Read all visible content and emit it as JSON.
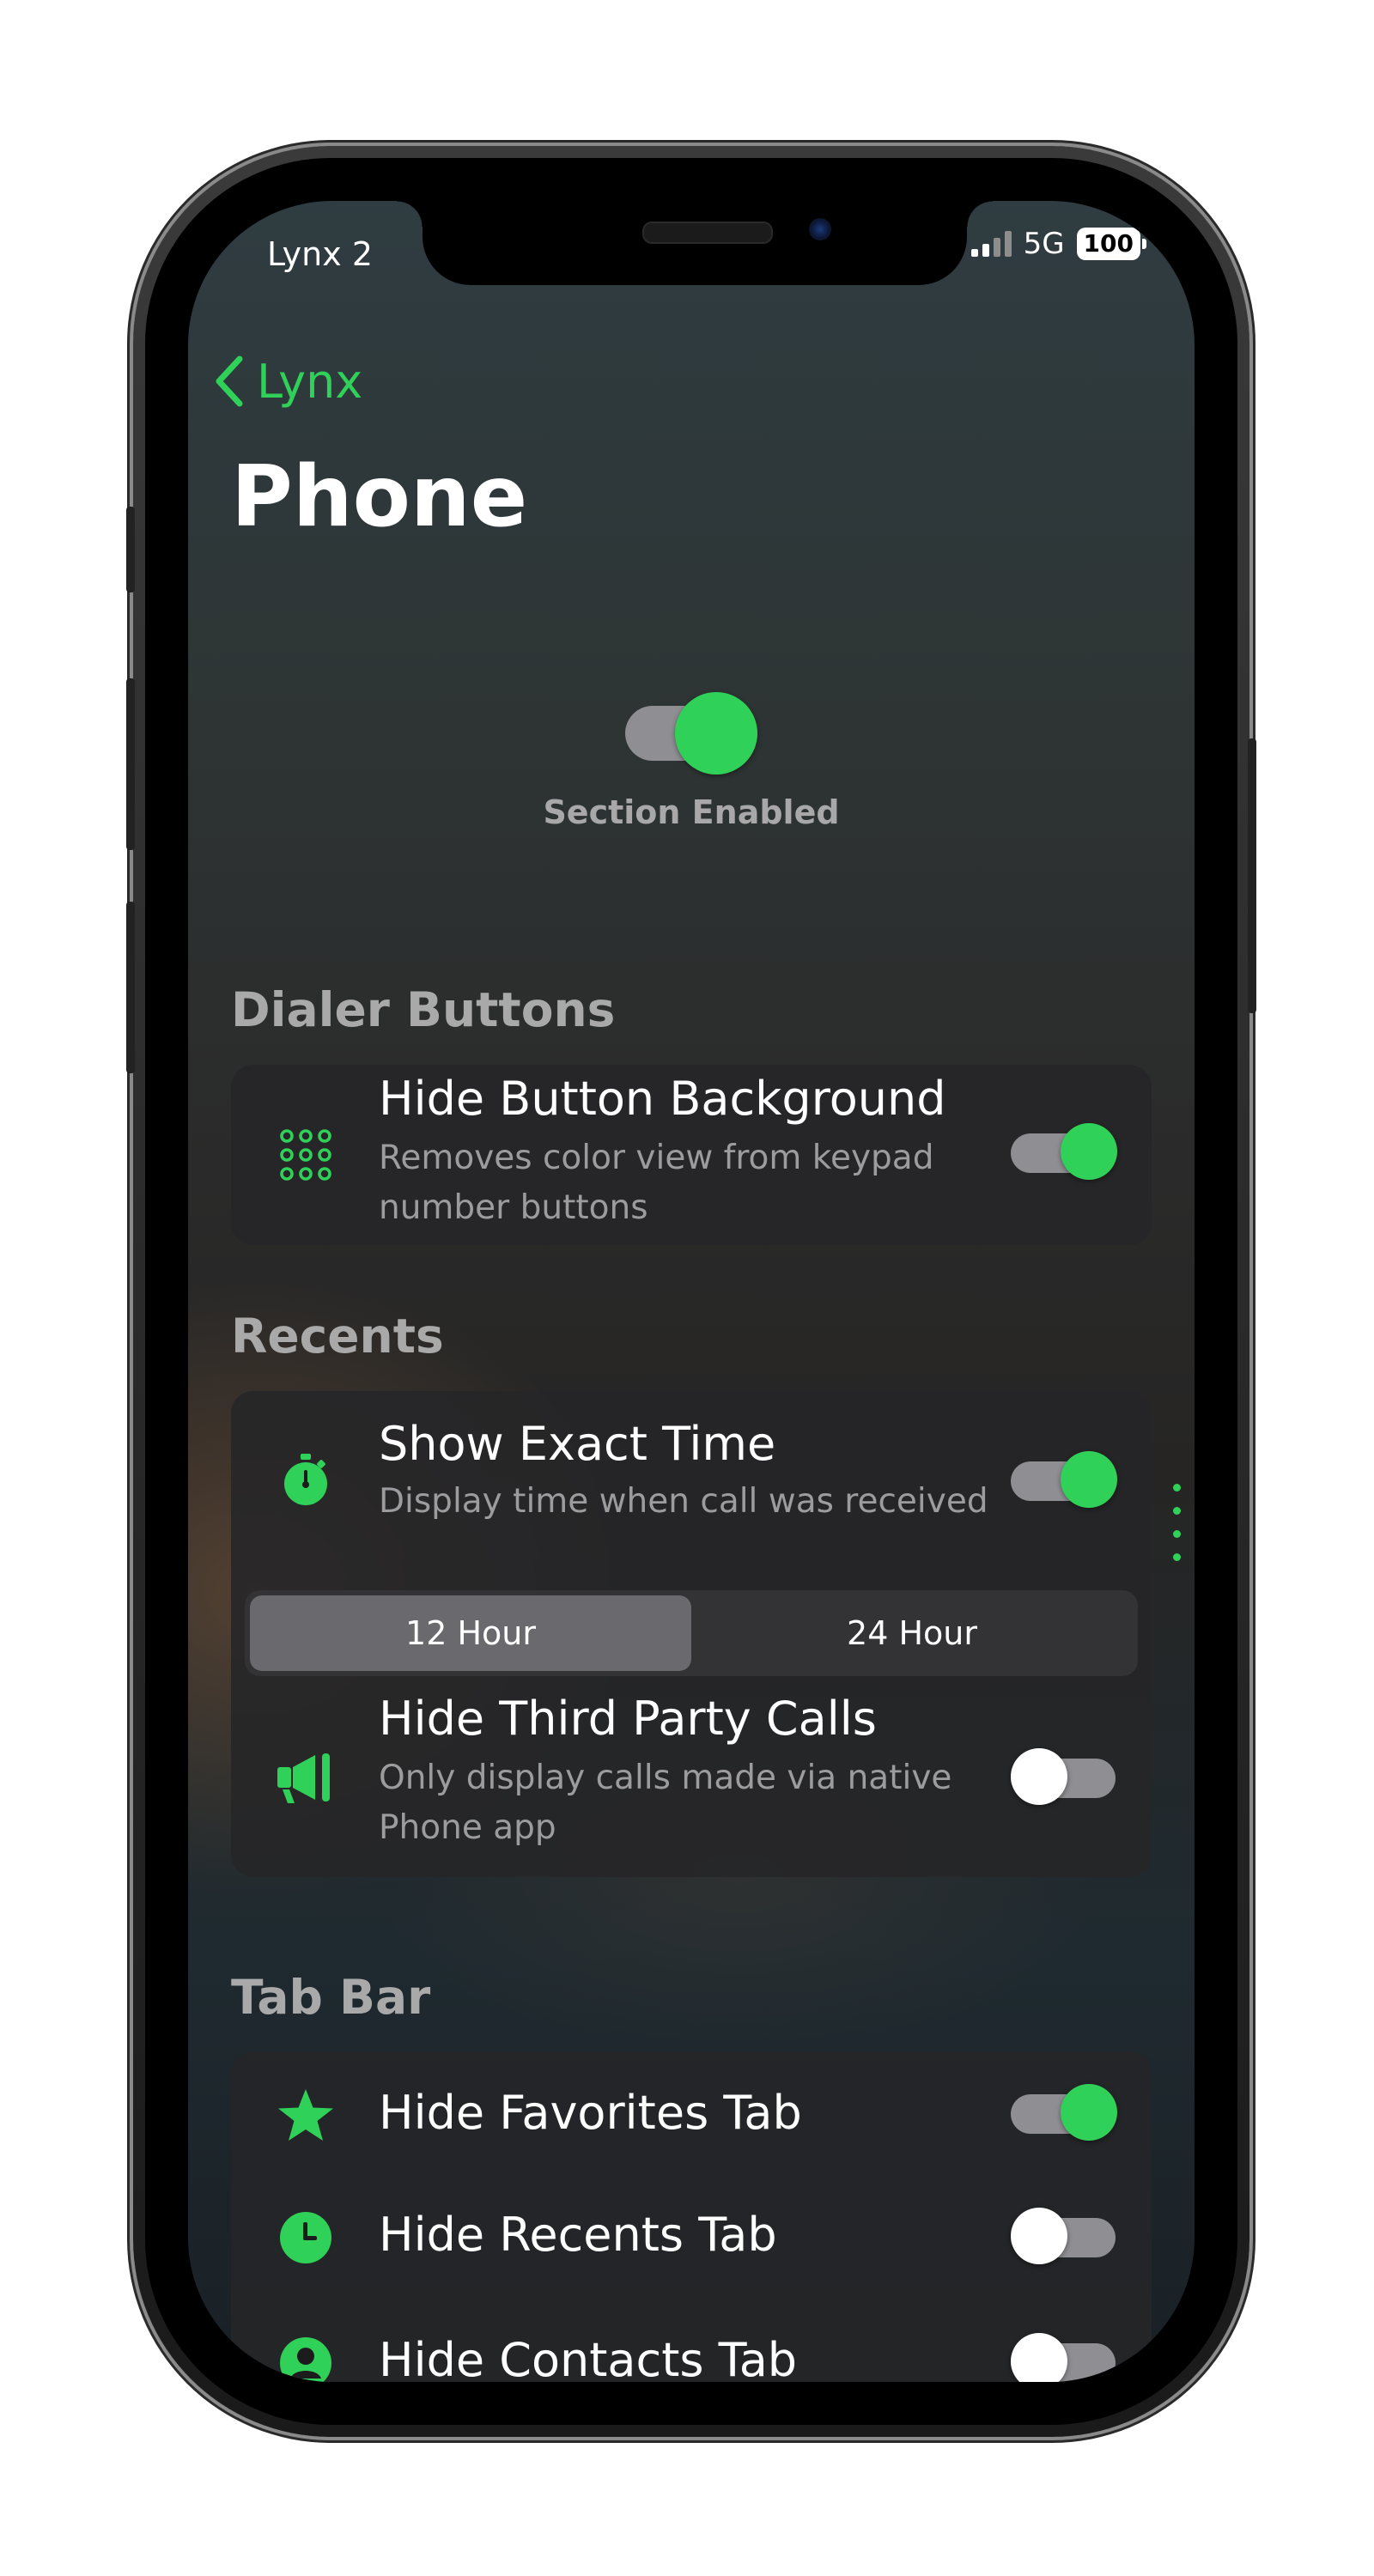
{
  "status_bar": {
    "carrier": "Lynx 2",
    "network": "5G",
    "battery": "100"
  },
  "nav": {
    "back_label": "Lynx",
    "title": "Phone"
  },
  "master_toggle": {
    "label": "Section Enabled",
    "on": true
  },
  "sections": {
    "dialer": {
      "header": "Dialer Buttons",
      "hide_button_background": {
        "title": "Hide Button Background",
        "subtitle": "Removes color view from keypad number buttons",
        "on": true
      }
    },
    "recents": {
      "header": "Recents",
      "show_exact_time": {
        "title": "Show Exact Time",
        "subtitle": "Display time when call was received",
        "on": true
      },
      "time_format": {
        "options": [
          "12 Hour",
          "24 Hour"
        ],
        "selected": "12 Hour"
      },
      "hide_third_party": {
        "title": "Hide Third Party Calls",
        "subtitle": "Only display calls made via native Phone app",
        "on": false
      }
    },
    "tab_bar": {
      "header": "Tab Bar",
      "hide_favorites": {
        "title": "Hide Favorites Tab",
        "on": true
      },
      "hide_recents": {
        "title": "Hide Recents Tab",
        "on": false
      },
      "hide_contacts": {
        "title": "Hide Contacts Tab",
        "on": false
      }
    }
  },
  "colors": {
    "accent": "#30d158",
    "toggle_track": "#8e8e93",
    "card": "#262628"
  },
  "icons": [
    "chevron-left-icon",
    "keypad-icon",
    "timer-icon",
    "megaphone-icon",
    "star-icon",
    "clock-icon",
    "person-icon"
  ]
}
